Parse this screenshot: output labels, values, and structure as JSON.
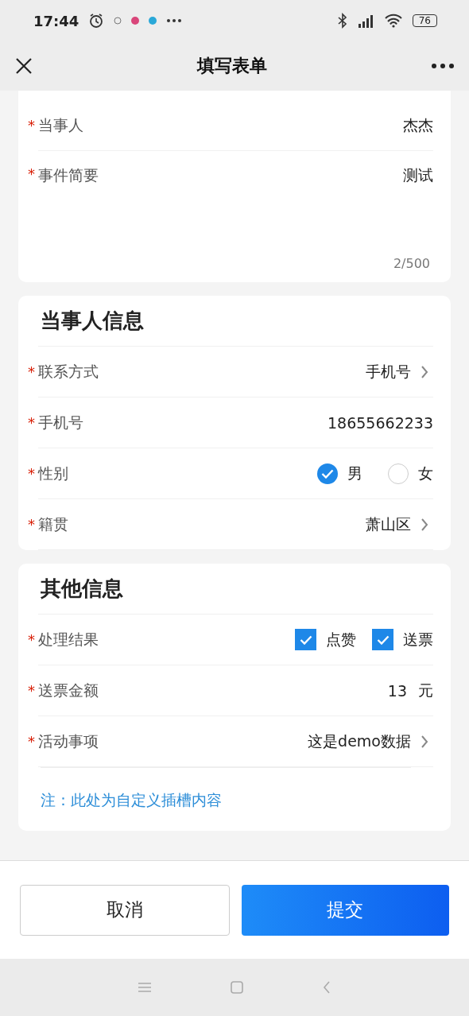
{
  "status_bar": {
    "time": "17:44",
    "battery": "76"
  },
  "nav": {
    "title": "填写表单"
  },
  "sections": [
    {
      "rows": [
        {
          "kind": "text",
          "required_mark": "*",
          "label": "当事人",
          "value": "杰杰"
        },
        {
          "kind": "textarea",
          "required_mark": "*",
          "label": "事件简要",
          "value": "测试",
          "counter": "2/500"
        }
      ]
    },
    {
      "title": "当事人信息",
      "rows": [
        {
          "kind": "select",
          "required_mark": "*",
          "label": "联系方式",
          "value": "手机号"
        },
        {
          "kind": "text",
          "required_mark": "*",
          "label": "手机号",
          "value": "18655662233"
        },
        {
          "kind": "radio",
          "required_mark": "*",
          "label": "性别",
          "options": [
            {
              "label": "男",
              "selected": true
            },
            {
              "label": "女",
              "selected": false
            }
          ]
        },
        {
          "kind": "select",
          "required_mark": "*",
          "label": "籍贯",
          "value": "萧山区"
        }
      ]
    },
    {
      "title": "其他信息",
      "rows": [
        {
          "kind": "checkbox",
          "required_mark": "*",
          "label": "处理结果",
          "options": [
            {
              "label": "点赞",
              "checked": true
            },
            {
              "label": "送票",
              "checked": true
            }
          ]
        },
        {
          "kind": "amount",
          "required_mark": "*",
          "label": "送票金额",
          "value": "13",
          "unit": "元"
        },
        {
          "kind": "select",
          "required_mark": "*",
          "label": "活动事项",
          "value": "这是demo数据"
        }
      ],
      "note": "注：此处为自定义插槽内容"
    }
  ],
  "buttons": [
    {
      "kind": "secondary",
      "label": "取消"
    },
    {
      "kind": "primary",
      "label": "提交"
    }
  ]
}
